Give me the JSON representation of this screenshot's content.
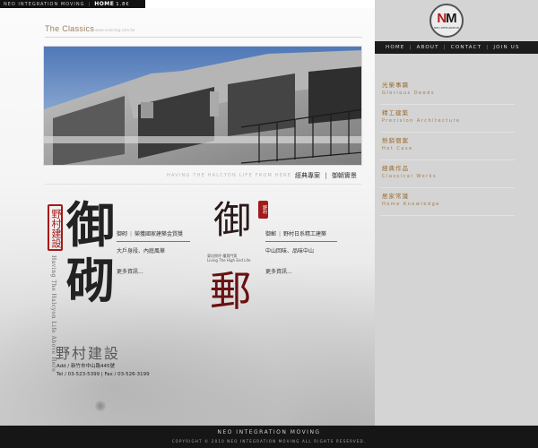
{
  "topbar": {
    "company": "NEO INTEGRATION MOVING",
    "home": "HOME",
    "home_suffix": "1.8€"
  },
  "main": {
    "section_title": "The Classics",
    "section_url": "www.neointeg.com.tw",
    "tagline": "HAVING THE HALCYON LIFE FROM HERE",
    "links": [
      "經典專案",
      "御朝實景"
    ]
  },
  "projects": [
    {
      "big_char": "御砌",
      "seal_text": "野村建設",
      "vertical_en": "Having The Halcyon Life Above Here",
      "title_a": "御砌",
      "title_b": "榮獲國家建築金質獎",
      "desc": "大戶身段、內庭風華",
      "more": "更多資訊..."
    },
    {
      "seal_text": "野村",
      "caption_1": "東坊院坪 權貴門第",
      "caption_2": "Living The High End Life",
      "title_a": "御郵",
      "title_b": "野村日系精工建築",
      "desc": "中山回味、品味中山",
      "more": "更多資訊..."
    }
  ],
  "contact": {
    "logo_text": "野村建設",
    "address": "Add / 新竹市中山路445號",
    "phone": "Tel / 03-523-5399",
    "fax": "Fax / 03-526-3199"
  },
  "sidebar": {
    "logo_brand": "NEO INTEGRATION",
    "nav": [
      "HOME",
      "ABOUT",
      "CONTACT",
      "JOIN US"
    ],
    "menu": [
      {
        "zh": "光榮事蹟",
        "en": "Glorious Deeds"
      },
      {
        "zh": "精工建築",
        "en": "Precision Architecture"
      },
      {
        "zh": "熱銷個案",
        "en": "Hot Case"
      },
      {
        "zh": "經典作品",
        "en": "Classical Works"
      },
      {
        "zh": "居家常識",
        "en": "Home Knowledge"
      }
    ]
  },
  "footer": {
    "title": "NEO INTEGRATION MOVING",
    "copyright": "COPYRIGHT © 2010 NEO INTEGRATION MOVING ALL RIGHTS RESERVED."
  },
  "colors": {
    "accent": "#9b6b2e",
    "seal_red": "#a31a1a",
    "nav_bg": "#1c1c1c",
    "sidebar_bg": "#d4d4d4"
  }
}
